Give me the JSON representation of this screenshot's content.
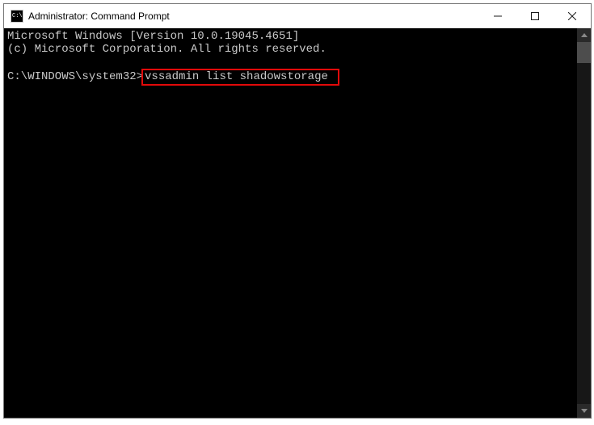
{
  "titlebar": {
    "title": "Administrator: Command Prompt"
  },
  "terminal": {
    "line1": "Microsoft Windows [Version 10.0.19045.4651]",
    "line2": "(c) Microsoft Corporation. All rights reserved.",
    "prompt": "C:\\WINDOWS\\system32>",
    "command": "vssadmin list shadowstorage"
  }
}
